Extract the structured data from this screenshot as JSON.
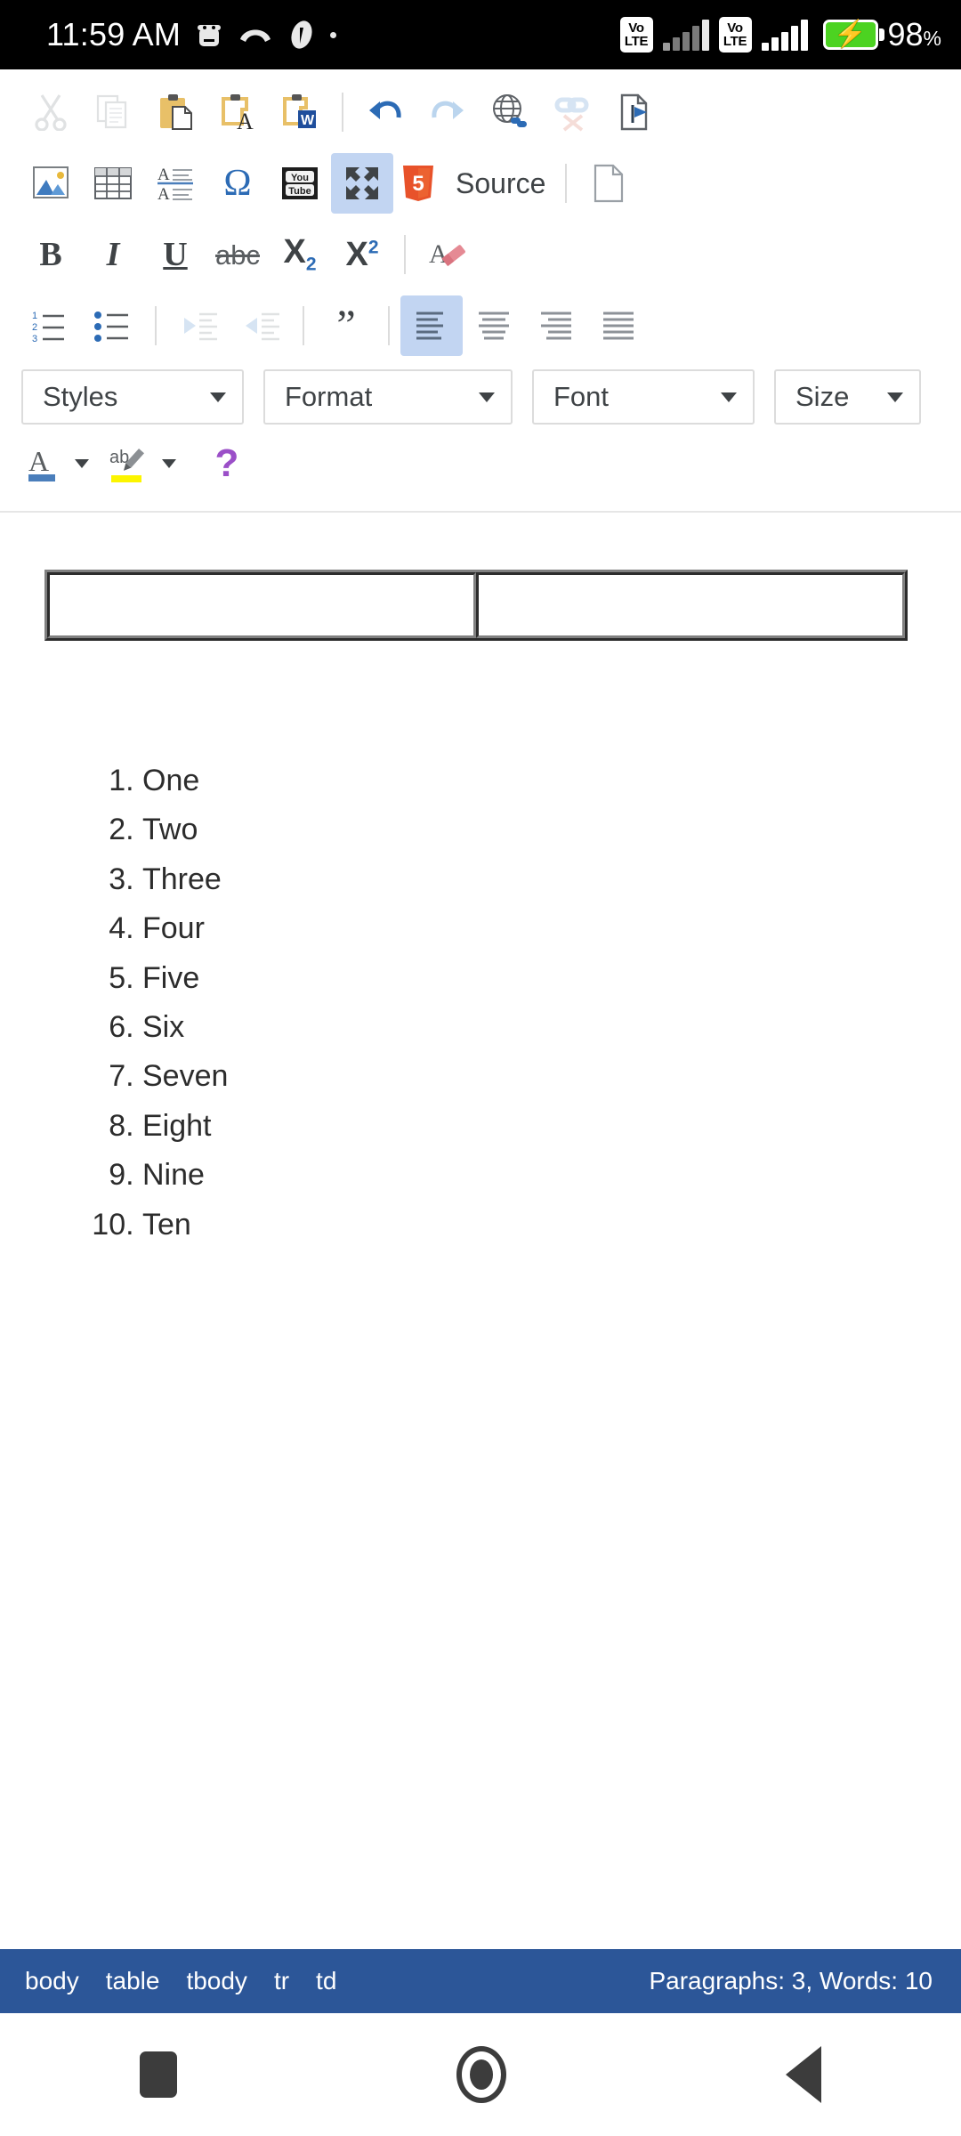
{
  "status_bar": {
    "clock": "11:59 AM",
    "icons": [
      "android-debug-icon",
      "missed-call-icon",
      "app-notification-icon",
      "dot-indicator-icon"
    ],
    "sim1_label_top": "Vo",
    "sim1_label_bottom": "LTE",
    "sim2_label_top": "Vo",
    "sim2_label_bottom": "LTE",
    "battery_percent": "98",
    "battery_percent_symbol": "%",
    "battery_charging": true,
    "battery_color": "#4cd321"
  },
  "toolbar": {
    "row1": [
      {
        "name": "cut-icon",
        "title": "Cut",
        "enabled": false
      },
      {
        "name": "copy-icon",
        "title": "Copy",
        "enabled": false
      },
      {
        "name": "paste-icon",
        "title": "Paste",
        "enabled": true
      },
      {
        "name": "paste-as-plain-text-icon",
        "title": "Paste as plain text",
        "enabled": true
      },
      {
        "name": "paste-from-word-icon",
        "title": "Paste from Word",
        "enabled": true
      },
      {
        "name": "separator",
        "title": "",
        "enabled": true
      },
      {
        "name": "undo-icon",
        "title": "Undo",
        "enabled": true
      },
      {
        "name": "redo-icon",
        "title": "Redo",
        "enabled": false
      },
      {
        "name": "link-icon",
        "title": "Link",
        "enabled": true
      },
      {
        "name": "unlink-icon",
        "title": "Unlink",
        "enabled": false
      },
      {
        "name": "anchor-icon",
        "title": "Anchor",
        "enabled": true
      }
    ],
    "row2": [
      {
        "name": "image-icon",
        "title": "Image",
        "enabled": true
      },
      {
        "name": "table-icon",
        "title": "Table",
        "enabled": true
      },
      {
        "name": "horizontal-rule-icon",
        "title": "Horizontal Line",
        "enabled": true
      },
      {
        "name": "special-character-icon",
        "title": "Insert Special Character",
        "enabled": true
      },
      {
        "name": "youtube-icon",
        "title": "Embed YouTube Video",
        "enabled": true
      },
      {
        "name": "maximize-icon",
        "title": "Maximize",
        "enabled": true,
        "active": true
      },
      {
        "name": "html5-source-icon",
        "title": "Source",
        "enabled": true
      },
      {
        "name": "separator",
        "title": "",
        "enabled": true
      },
      {
        "name": "new-page-icon",
        "title": "New Page",
        "enabled": true
      }
    ],
    "source_label": "Source",
    "row3": [
      {
        "name": "bold-icon",
        "title": "Bold",
        "label": "B",
        "enabled": true
      },
      {
        "name": "italic-icon",
        "title": "Italic",
        "label": "I",
        "enabled": true
      },
      {
        "name": "underline-icon",
        "title": "Underline",
        "label": "U",
        "enabled": true
      },
      {
        "name": "strikethrough-icon",
        "title": "Strike Through",
        "label": "abc",
        "enabled": true
      },
      {
        "name": "subscript-icon",
        "title": "Subscript",
        "label": "X",
        "sup": "2",
        "enabled": true
      },
      {
        "name": "superscript-icon",
        "title": "Superscript",
        "label": "X",
        "sup": "2",
        "enabled": true
      },
      {
        "name": "separator",
        "title": "",
        "enabled": true
      },
      {
        "name": "remove-format-icon",
        "title": "Remove Format",
        "enabled": true
      }
    ],
    "row4": [
      {
        "name": "numbered-list-icon",
        "title": "Insert/Remove Numbered List",
        "enabled": true
      },
      {
        "name": "bulleted-list-icon",
        "title": "Insert/Remove Bulleted List",
        "enabled": true
      },
      {
        "name": "separator",
        "title": "",
        "enabled": true
      },
      {
        "name": "decrease-indent-icon",
        "title": "Decrease Indent",
        "enabled": false
      },
      {
        "name": "increase-indent-icon",
        "title": "Increase Indent",
        "enabled": false
      },
      {
        "name": "separator",
        "title": "",
        "enabled": true
      },
      {
        "name": "blockquote-icon",
        "title": "Block Quote",
        "enabled": true
      },
      {
        "name": "separator",
        "title": "",
        "enabled": true
      },
      {
        "name": "align-left-icon",
        "title": "Align Left",
        "enabled": true,
        "active": true
      },
      {
        "name": "align-center-icon",
        "title": "Center",
        "enabled": true
      },
      {
        "name": "align-right-icon",
        "title": "Align Right",
        "enabled": true
      },
      {
        "name": "justify-icon",
        "title": "Justify",
        "enabled": true
      }
    ],
    "dropdowns": [
      {
        "name": "styles-dropdown",
        "label": "Styles"
      },
      {
        "name": "format-dropdown",
        "label": "Format"
      },
      {
        "name": "font-dropdown",
        "label": "Font"
      },
      {
        "name": "size-dropdown",
        "label": "Size"
      }
    ],
    "row6": [
      {
        "name": "text-color-icon",
        "title": "Text Color",
        "label": "A",
        "swatch": "#4a7ebb",
        "enabled": true
      },
      {
        "name": "background-color-icon",
        "title": "Background Color",
        "label": "ab",
        "swatch": "#fcf500",
        "enabled": true
      },
      {
        "name": "about-ckeditor-icon",
        "title": "About CKEditor",
        "label": "?",
        "color": "#9b4fc8",
        "enabled": true
      }
    ]
  },
  "document": {
    "table": {
      "rows": 1,
      "columns": 2,
      "cells": [
        [
          "",
          ""
        ]
      ]
    },
    "list": {
      "type": "ordered",
      "items": [
        "One",
        "Two",
        "Three",
        "Four",
        "Five",
        "Six",
        "Seven",
        "Eight",
        "Nine",
        "Ten"
      ]
    }
  },
  "elements_path": {
    "items": [
      "body",
      "table",
      "tbody",
      "tr",
      "td"
    ],
    "word_count": "Paragraphs: 3, Words: 10",
    "background_color": "#2c5698"
  },
  "nav_bar": {
    "buttons": [
      {
        "name": "recents-button",
        "label": "Recents"
      },
      {
        "name": "home-button",
        "label": "Home"
      },
      {
        "name": "back-button",
        "label": "Back"
      }
    ]
  }
}
